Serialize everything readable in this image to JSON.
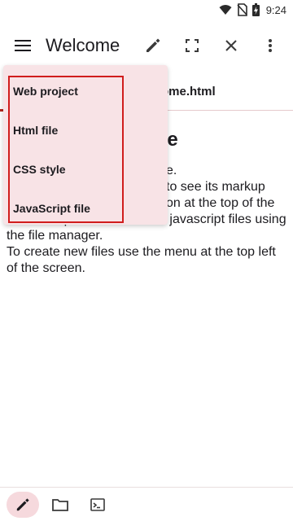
{
  "status_bar": {
    "time": "9:24",
    "icons": [
      "wifi-icon",
      "no-sim-icon",
      "battery-charging-icon"
    ]
  },
  "app_bar": {
    "title": "Welcome",
    "menu_icon": "hamburger-menu-icon",
    "actions": [
      "edit-icon",
      "fullscreen-icon",
      "close-icon",
      "more-vert-icon"
    ]
  },
  "tab": {
    "label": "ome.html"
  },
  "content": {
    "heading": "me",
    "lines": [
      "e.",
      "to see its markup",
      "on at the top of the",
      "You can open html, css and javascript files using",
      "the file manager.",
      "To create new files use the menu at the top left",
      "of the screen."
    ]
  },
  "menu": {
    "items": [
      "Web project",
      "Html file",
      "CSS style",
      "JavaScript file"
    ]
  },
  "bottom_bar": {
    "buttons": [
      "edit-icon",
      "folder-icon",
      "terminal-icon"
    ]
  },
  "colors": {
    "accent": "#b3261e",
    "menu_bg": "#f8e3e6",
    "highlight": "#d01d1d"
  }
}
